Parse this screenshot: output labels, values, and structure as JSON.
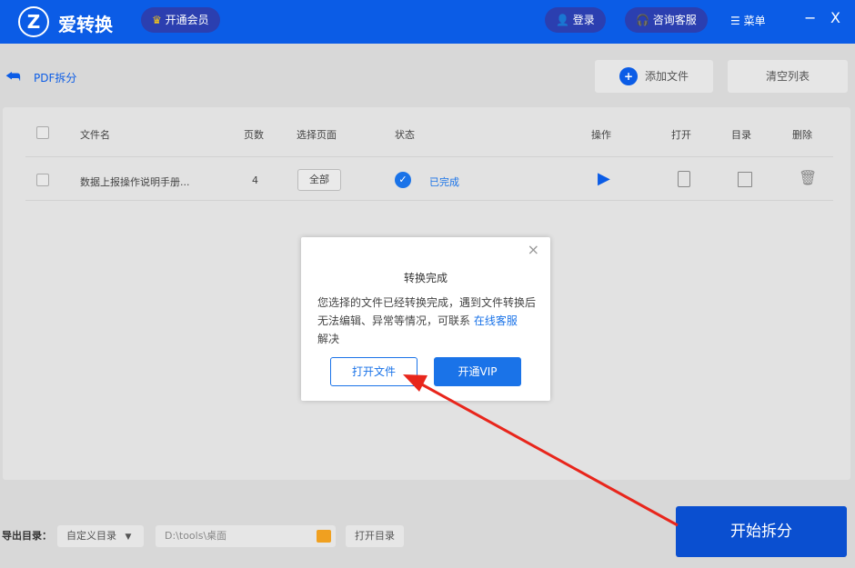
{
  "header": {
    "logo": "Z",
    "app_name": "爱转换",
    "vip": "开通会员",
    "login": "登录",
    "support": "咨询客服",
    "menu": "菜单",
    "minimize": "−",
    "close": "X"
  },
  "toolbar": {
    "title": "PDF拆分",
    "add_file": "添加文件",
    "clear_list": "清空列表"
  },
  "table": {
    "columns": [
      "文件名",
      "页数",
      "选择页面",
      "状态",
      "操作",
      "打开",
      "目录",
      "删除"
    ],
    "rows": [
      {
        "name": "数据上报操作说明手册...",
        "pages": "4",
        "select": "全部",
        "status": "已完成"
      }
    ]
  },
  "footer": {
    "label": "导出目录：",
    "mode": "自定义目录",
    "path": "D:\\tools\\桌面",
    "open_dir": "打开目录",
    "start": "开始拆分"
  },
  "modal": {
    "title": "转换完成",
    "body": "您选择的文件已经转换完成，遇到文件转换后无法编辑、异常等情况，可联系 ",
    "link": "在线客服",
    "body_end": "解决",
    "open_file": "打开文件",
    "vip": "开通VIP",
    "close": "×"
  },
  "colors": {
    "primary": "#0b5ce6",
    "arrow": "#e8261c"
  }
}
